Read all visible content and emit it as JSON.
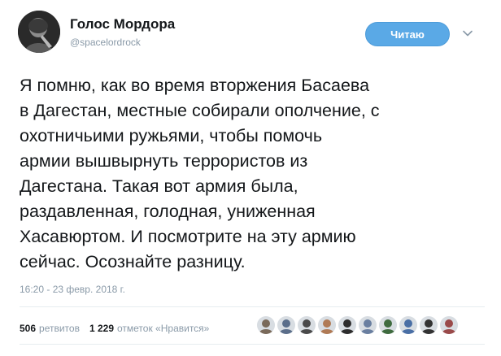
{
  "author": {
    "display_name": "Голос Мордора",
    "screen_name": "@spacelordrock",
    "avatar_icon": "profile-photo"
  },
  "follow_button": {
    "label": "Читаю",
    "color": "#5aa9e6"
  },
  "menu_icon": "chevron-down-icon",
  "tweet": {
    "lines": [
      "Я помню, как во время вторжения Басаева",
      "в Дагестан, местные собирали ополчение, с",
      "охотничьими ружьями, чтобы помочь",
      "армии вышвырнуть террористов из",
      "Дагестана. Такая вот армия была,",
      "раздавленная, голодная, униженная",
      "Хасавюртом. И посмотрите на эту армию",
      "сейчас. Осознайте разницу."
    ],
    "timestamp": "16:20 - 23 февр. 2018 г."
  },
  "stats": {
    "retweets_count": "506",
    "retweets_label": "ретвитов",
    "likes_count": "1 229",
    "likes_label": "отметок «Нравится»"
  },
  "likers": [
    {
      "name": "liker-avatar-1",
      "color": "#7a6a5a"
    },
    {
      "name": "liker-avatar-2",
      "color": "#5b6e8a"
    },
    {
      "name": "liker-avatar-3",
      "color": "#4a4a4a"
    },
    {
      "name": "liker-avatar-4",
      "color": "#b07a55"
    },
    {
      "name": "liker-avatar-5",
      "color": "#2d2d2d"
    },
    {
      "name": "liker-avatar-6",
      "color": "#6a7fa0"
    },
    {
      "name": "liker-avatar-7",
      "color": "#3f6b3f"
    },
    {
      "name": "liker-avatar-8",
      "color": "#4a6fa5"
    },
    {
      "name": "liker-avatar-9",
      "color": "#333333"
    },
    {
      "name": "liker-avatar-10",
      "color": "#9a4a4a"
    }
  ],
  "colors": {
    "text": "#14171a",
    "secondary": "#8a9aa8",
    "divider": "#e6ecf0"
  }
}
